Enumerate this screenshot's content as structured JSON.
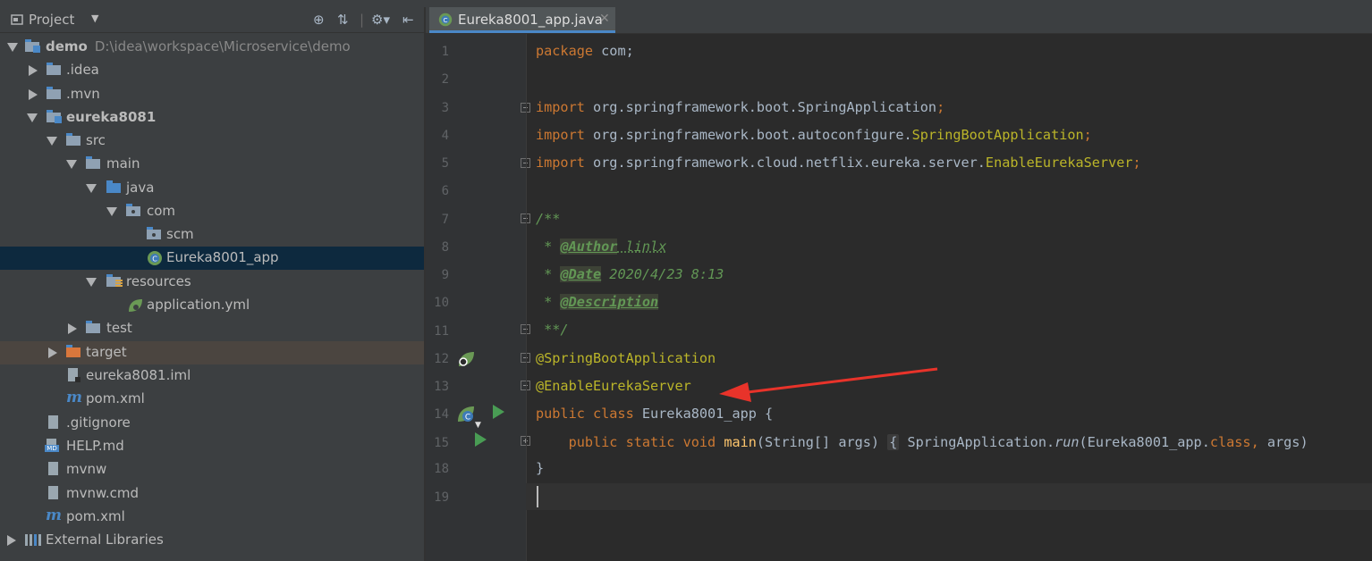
{
  "project_panel": {
    "title": "Project",
    "toolbar_icons": [
      "locate-icon",
      "collapse-icon",
      "gear-icon",
      "hide-icon"
    ],
    "tree": [
      {
        "label": "demo",
        "path": "D:\\idea\\workspace\\Microservice\\demo",
        "icon": "module-folder-icon",
        "expanded": true
      },
      {
        "label": ".idea",
        "icon": "folder-icon",
        "expanded": false
      },
      {
        "label": ".mvn",
        "icon": "folder-icon",
        "expanded": false
      },
      {
        "label": "eureka8081",
        "icon": "module-folder-icon",
        "expanded": true
      },
      {
        "label": "src",
        "icon": "folder-icon",
        "expanded": true
      },
      {
        "label": "main",
        "icon": "folder-icon",
        "expanded": true
      },
      {
        "label": "java",
        "icon": "source-folder-icon",
        "expanded": true
      },
      {
        "label": "com",
        "icon": "package-icon",
        "expanded": true
      },
      {
        "label": "scm",
        "icon": "package-icon"
      },
      {
        "label": "Eureka8001_app",
        "icon": "spring-class-icon",
        "selected": true
      },
      {
        "label": "resources",
        "icon": "resources-folder-icon",
        "expanded": true
      },
      {
        "label": "application.yml",
        "icon": "spring-config-icon"
      },
      {
        "label": "test",
        "icon": "folder-icon",
        "expanded": false
      },
      {
        "label": "target",
        "icon": "excluded-folder-icon",
        "expanded": false
      },
      {
        "label": "eureka8081.iml",
        "icon": "iml-file-icon"
      },
      {
        "label": "pom.xml",
        "icon": "maven-icon"
      },
      {
        "label": ".gitignore",
        "icon": "file-icon"
      },
      {
        "label": "HELP.md",
        "icon": "markdown-icon"
      },
      {
        "label": "mvnw",
        "icon": "file-icon"
      },
      {
        "label": "mvnw.cmd",
        "icon": "file-icon"
      },
      {
        "label": "pom.xml",
        "icon": "maven-icon"
      },
      {
        "label": "External Libraries",
        "icon": "libraries-icon",
        "expanded": false
      }
    ]
  },
  "editor": {
    "tab_label": "Eureka8001_app.java",
    "line_numbers": [
      "1",
      "2",
      "3",
      "4",
      "5",
      "6",
      "7",
      "8",
      "9",
      "10",
      "11",
      "12",
      "13",
      "14",
      "15",
      "18",
      "19"
    ],
    "code": {
      "l1_kw": "package",
      "l1_rest": " com;",
      "l3_kw": "import",
      "l3_pkg": " org.springframework.boot.SpringApplication",
      "l3_semi": ";",
      "l4_kw": "import",
      "l4_pkg": " org.springframework.boot.autoconfigure.",
      "l4_cls": "SpringBootApplication",
      "l4_semi": ";",
      "l5_kw": "import",
      "l5_pkg": " org.springframework.cloud.netflix.eureka.server.",
      "l5_cls": "EnableEurekaServer",
      "l5_semi": ";",
      "l7": "/**",
      "l8_star": " * ",
      "l8_tag": "@Author",
      "l8_val": " linlx",
      "l9_star": " * ",
      "l9_tag": "@Date",
      "l9_val": " 2020/4/23 8:13",
      "l10_star": " * ",
      "l10_tag": "@Description",
      "l11": " **/",
      "l12": "@SpringBootApplication",
      "l13": "@EnableEurekaServer",
      "l14_kw": "public class",
      "l14_rest": " Eureka8001_app {",
      "l15_kw": "public static void",
      "l15_fn": "main",
      "l15_args": "(String[] args) ",
      "l15_body_open": "{",
      "l15_body_cls": " SpringApplication.",
      "l15_body_run": "run",
      "l15_body_args": "(Eureka8001_app.",
      "l15_body_kw": "class,",
      "l15_body_tail": " args)",
      "l18": "}"
    },
    "colors": {
      "keyword": "#cc7832",
      "annotation": "#bbb529",
      "doc": "#629755",
      "method": "#ffc66d",
      "text": "#a9b7c6"
    }
  }
}
